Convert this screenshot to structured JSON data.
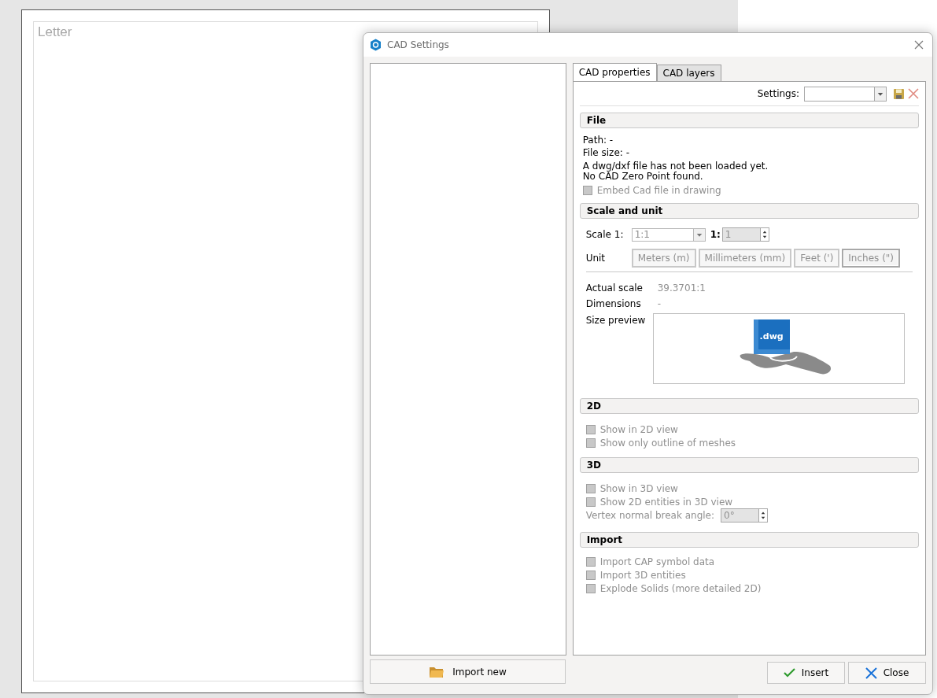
{
  "sheet": {
    "label": "Letter"
  },
  "dialog": {
    "title": "CAD Settings"
  },
  "tabs": [
    {
      "label": "CAD properties",
      "selected": true
    },
    {
      "label": "CAD layers",
      "selected": false
    }
  ],
  "settings": {
    "label": "Settings:"
  },
  "file": {
    "title": "File",
    "path": "Path: -",
    "size": "File size: -",
    "message": "A dwg/dxf file has not been loaded yet.",
    "zero_point": "No CAD Zero Point found.",
    "checkboxes": [
      {
        "label": "Embed Cad file in drawing",
        "checked": false,
        "disabled": true
      }
    ]
  },
  "scale": {
    "title": "Scale and unit",
    "scale_label": "Scale 1:",
    "scale_value": "1:1",
    "ratio_label": "1:",
    "ratio_value": "1",
    "unit_label": "Unit",
    "units": [
      {
        "label": "Meters (m)",
        "selected": false
      },
      {
        "label": "Millimeters (mm)",
        "selected": false
      },
      {
        "label": "Feet (')",
        "selected": false
      },
      {
        "label": "Inches (\")",
        "selected": true
      }
    ],
    "actual_label": "Actual scale",
    "actual_value": "39.3701:1",
    "dimensions_label": "Dimensions",
    "dimensions_value": "-",
    "preview_label": "Size preview",
    "preview_badge": ".dwg"
  },
  "section_2d": {
    "title": "2D",
    "checkboxes": [
      {
        "label": "Show in 2D view",
        "checked": false,
        "disabled": true
      },
      {
        "label": "Show only outline of meshes",
        "checked": false,
        "disabled": true
      }
    ]
  },
  "section_3d": {
    "title": "3D",
    "checkboxes": [
      {
        "label": "Show in 3D view",
        "checked": false,
        "disabled": true
      },
      {
        "label": "Show 2D entities in 3D view",
        "checked": false,
        "disabled": true
      }
    ],
    "angle_label": "Vertex normal break angle:",
    "angle_value": "0°"
  },
  "import": {
    "title": "Import",
    "checkboxes": [
      {
        "label": "Import CAP symbol data",
        "checked": false,
        "disabled": true
      },
      {
        "label": "Import 3D entities",
        "checked": false,
        "disabled": true
      },
      {
        "label": "Explode Solids (more detailed 2D)",
        "checked": false,
        "disabled": true
      }
    ]
  },
  "buttons": {
    "import_new": "Import new",
    "insert": "Insert",
    "close": "Close"
  }
}
